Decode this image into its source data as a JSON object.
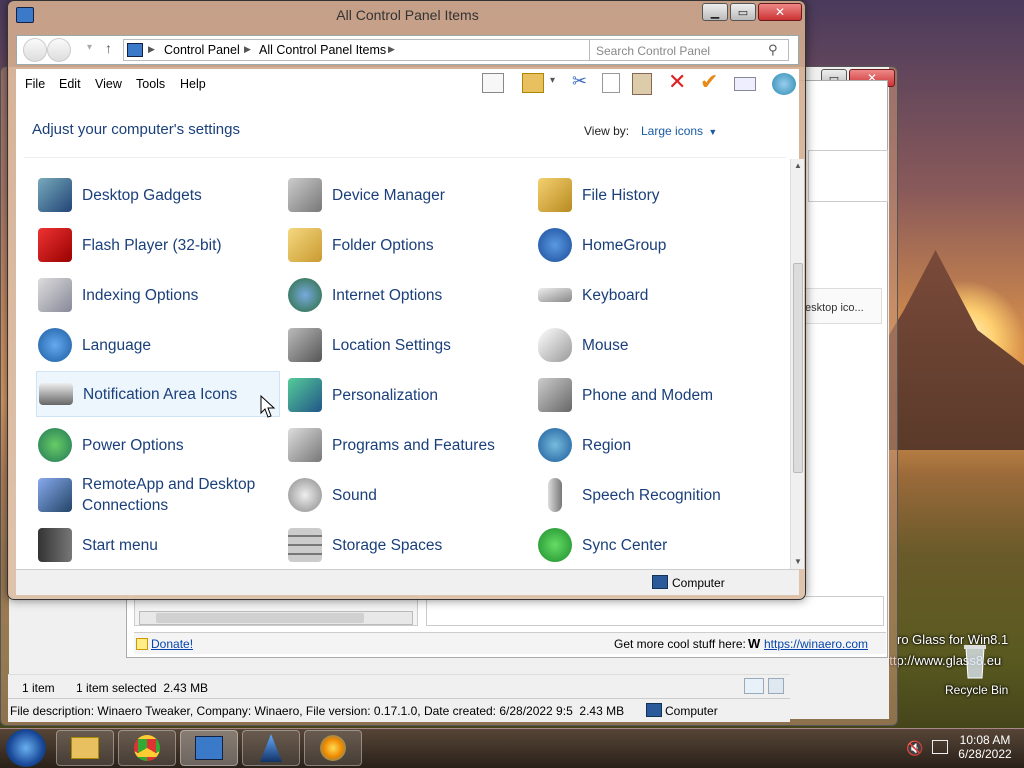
{
  "window": {
    "title": "All Control Panel Items"
  },
  "address": {
    "crumbs": [
      "Control Panel",
      "All Control Panel Items"
    ],
    "search_placeholder": "Search Control Panel"
  },
  "menu": [
    "File",
    "Edit",
    "View",
    "Tools",
    "Help"
  ],
  "header": {
    "heading": "Adjust your computer's settings",
    "view_by_label": "View by:",
    "view_by_value": "Large icons"
  },
  "items": [
    [
      "Desktop Gadgets",
      "Device Manager",
      "File History"
    ],
    [
      "Flash Player (32-bit)",
      "Folder Options",
      "HomeGroup"
    ],
    [
      "Indexing Options",
      "Internet Options",
      "Keyboard"
    ],
    [
      "Language",
      "Location Settings",
      "Mouse"
    ],
    [
      "Notification Area Icons",
      "Personalization",
      "Phone and Modem"
    ],
    [
      "Power Options",
      "Programs and Features",
      "Region"
    ],
    [
      "RemoteApp and Desktop Connections",
      "Sound",
      "Speech Recognition"
    ],
    [
      "Start menu",
      "Storage Spaces",
      "Sync Center"
    ]
  ],
  "status": {
    "location": "Computer"
  },
  "bg_window": {
    "partial_item": "esktop ico...",
    "donate": "Donate!",
    "more_stuff": "Get more cool stuff here:",
    "link": "https://winaero.com",
    "status_count": "1 item",
    "status_selected": "1 item selected  2.43 MB",
    "file_desc": "File description: Winaero Tweaker, Company: Winaero, File version: 0.17.1.0, Date created: 6/28/2022 9:5  2.43 MB",
    "location": "Computer"
  },
  "desktop": {
    "glass_text1": "ro Glass for Win8.1",
    "glass_text2": "http://www.glass8.eu",
    "recycle_bin": "Recycle Bin"
  },
  "taskbar": {
    "time": "10:08 AM",
    "date": "6/28/2022"
  },
  "colors": {
    "link": "#1a3f7a",
    "accent": "#3399ff"
  }
}
